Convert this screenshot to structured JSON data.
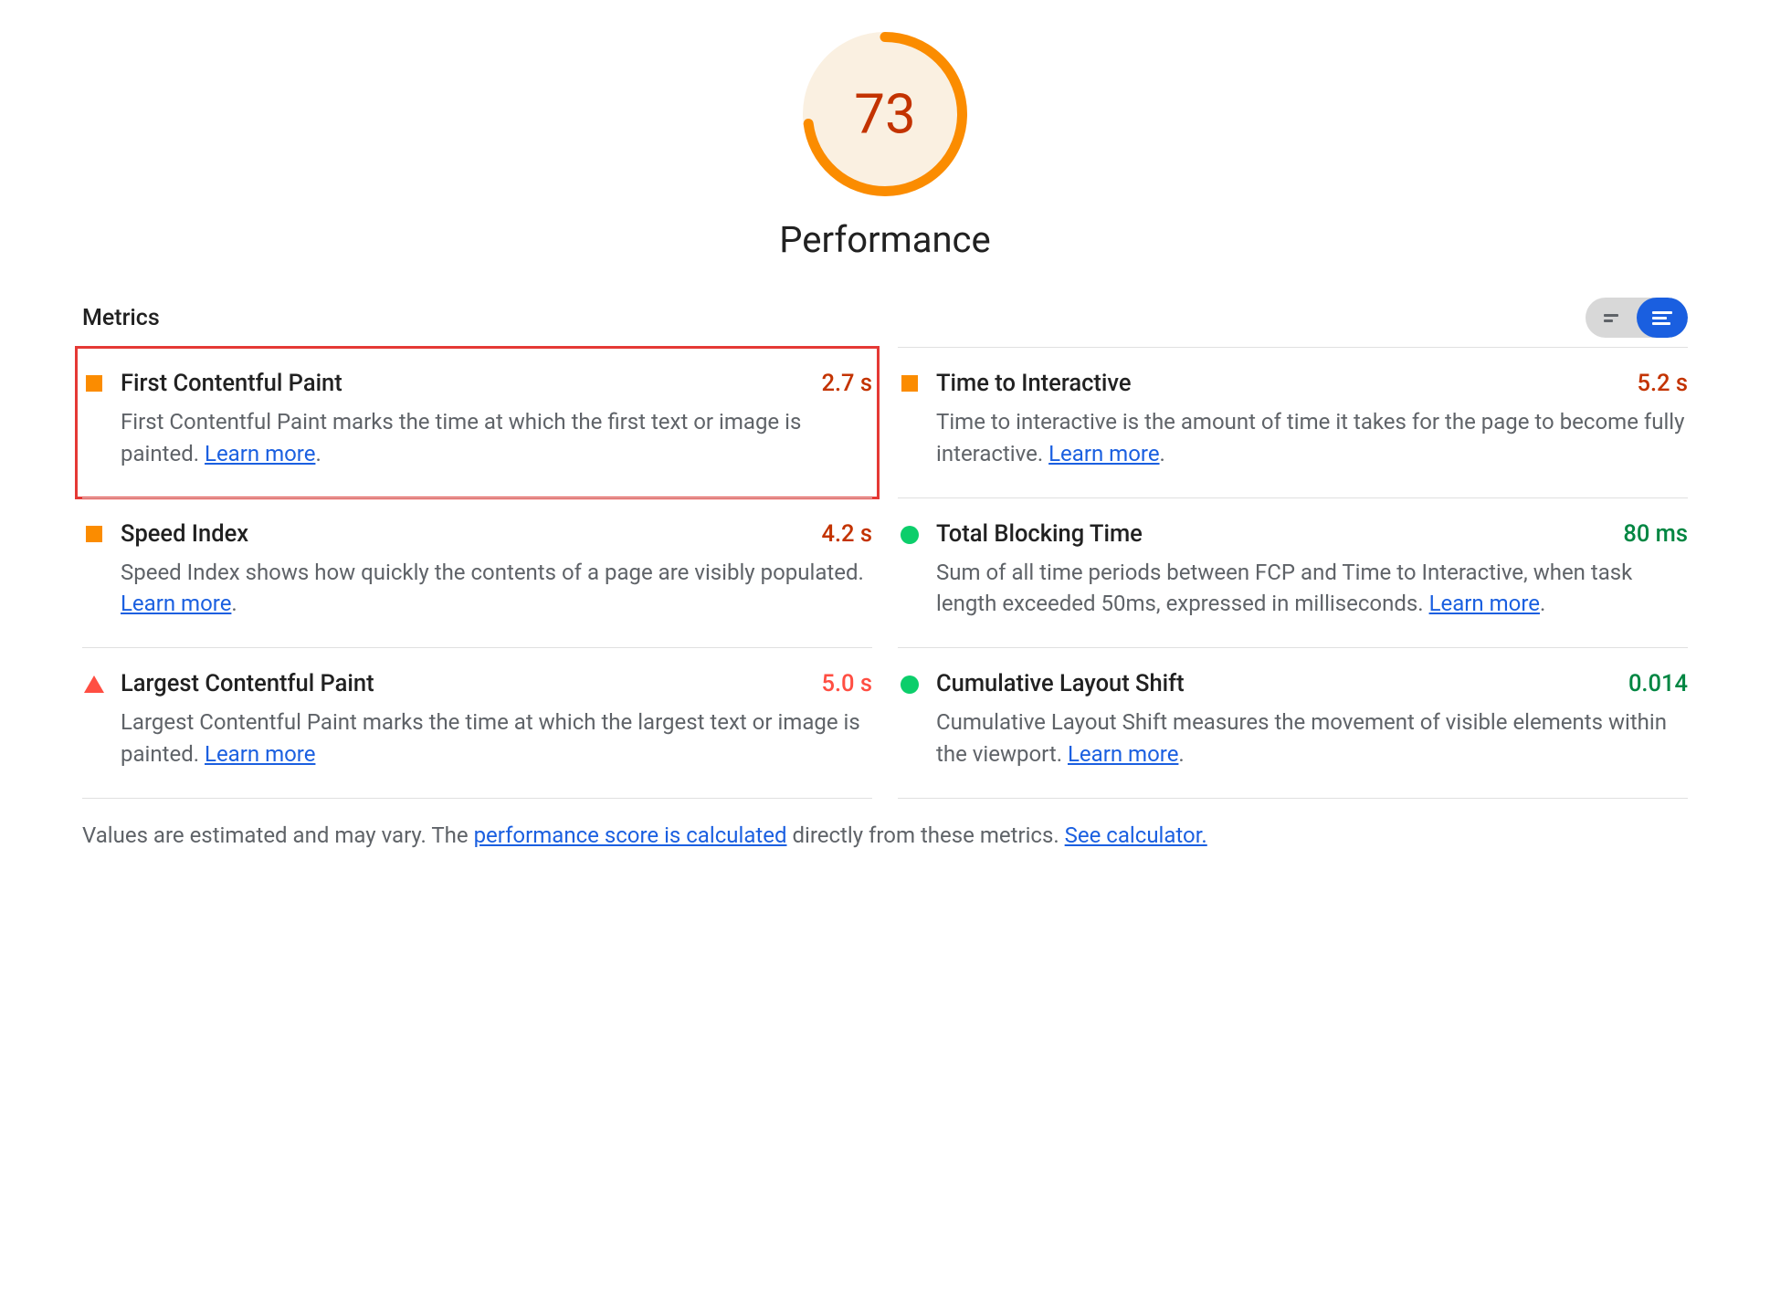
{
  "gauge": {
    "score": "73",
    "percent": 73,
    "color": "#fb8c00",
    "bg": "#faf0e1"
  },
  "title": "Performance",
  "metrics_label": "Metrics",
  "metrics": [
    {
      "title": "First Contentful Paint",
      "value": "2.7 s",
      "status": "avg",
      "icon": "square",
      "highlighted": true,
      "desc_pre": "First Contentful Paint marks the time at which the first text or image is painted. ",
      "learn": "Learn more",
      "desc_post": "."
    },
    {
      "title": "Time to Interactive",
      "value": "5.2 s",
      "status": "avg",
      "icon": "square",
      "highlighted": false,
      "desc_pre": "Time to interactive is the amount of time it takes for the page to become fully interactive. ",
      "learn": "Learn more",
      "desc_post": "."
    },
    {
      "title": "Speed Index",
      "value": "4.2 s",
      "status": "avg",
      "icon": "square",
      "highlighted": false,
      "desc_pre": "Speed Index shows how quickly the contents of a page are visibly populated. ",
      "learn": "Learn more",
      "desc_post": "."
    },
    {
      "title": "Total Blocking Time",
      "value": "80 ms",
      "status": "good",
      "icon": "circle",
      "highlighted": false,
      "desc_pre": "Sum of all time periods between FCP and Time to Interactive, when task length exceeded 50ms, expressed in milliseconds. ",
      "learn": "Learn more",
      "desc_post": "."
    },
    {
      "title": "Largest Contentful Paint",
      "value": "5.0 s",
      "status": "fail",
      "icon": "triangle",
      "highlighted": false,
      "desc_pre": "Largest Contentful Paint marks the time at which the largest text or image is painted. ",
      "learn": "Learn more",
      "desc_post": ""
    },
    {
      "title": "Cumulative Layout Shift",
      "value": "0.014",
      "status": "good",
      "icon": "circle",
      "highlighted": false,
      "desc_pre": "Cumulative Layout Shift measures the movement of visible elements within the viewport. ",
      "learn": "Learn more",
      "desc_post": "."
    }
  ],
  "footnote": {
    "pre": "Values are estimated and may vary. The ",
    "link1": "performance score is calculated",
    "mid": " directly from these metrics. ",
    "link2": "See calculator."
  }
}
